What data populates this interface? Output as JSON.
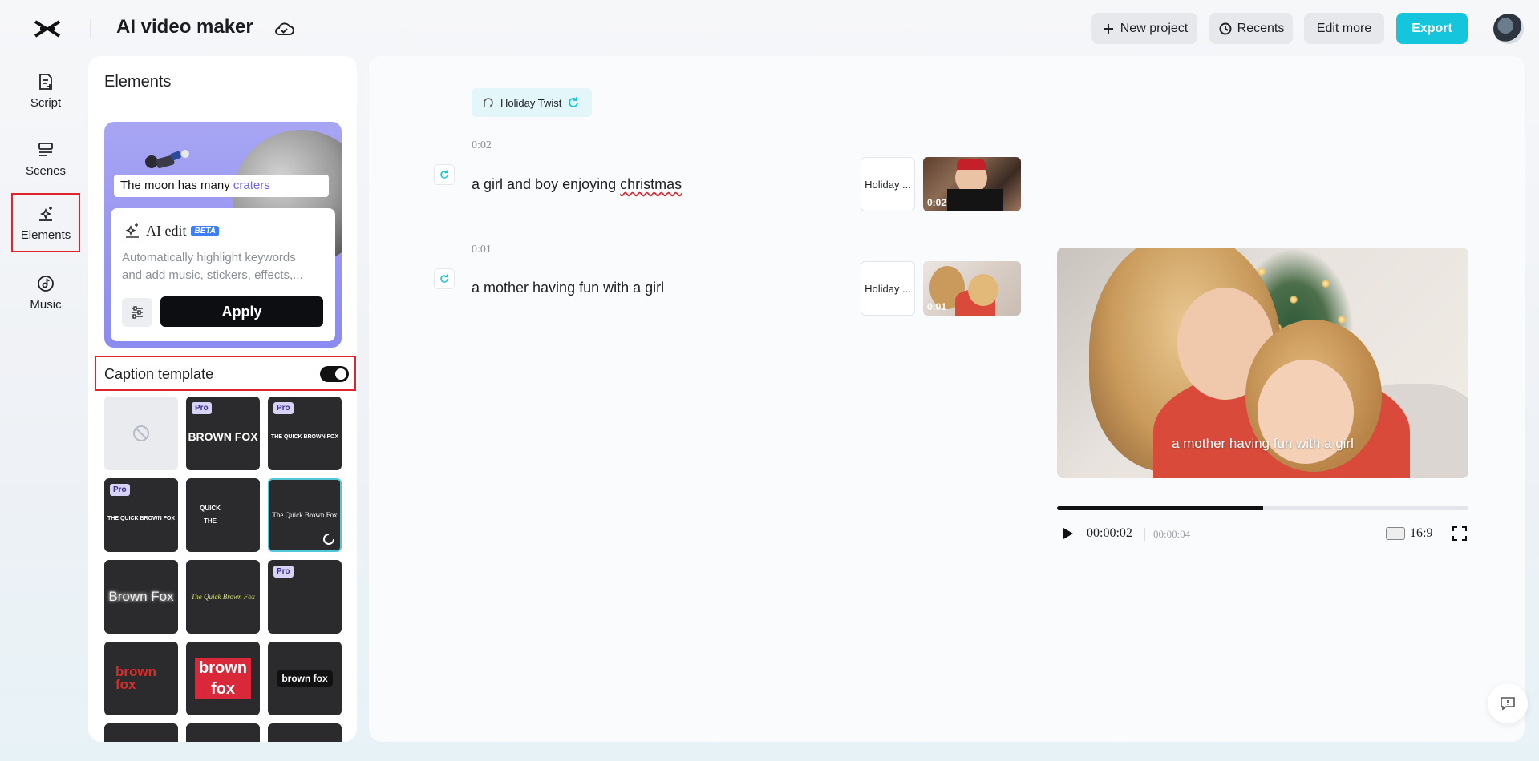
{
  "app": {
    "title": "AI video maker"
  },
  "toolbar": {
    "new_project": "New project",
    "recents": "Recents",
    "edit_more": "Edit more",
    "export": "Export"
  },
  "nav": [
    {
      "label": "Script",
      "icon": "script-icon"
    },
    {
      "label": "Scenes",
      "icon": "scenes-icon"
    },
    {
      "label": "Elements",
      "icon": "elements-sparkle-icon",
      "selected": true
    },
    {
      "label": "Music",
      "icon": "music-icon"
    }
  ],
  "panel": {
    "title": "Elements",
    "ai_card": {
      "caption_plain": "The moon has many ",
      "caption_highlight": "craters",
      "heading": "AI edit",
      "badge": "BETA",
      "desc_line1": "Automatically highlight keywords",
      "desc_line2": "and add music, stickers, effects,...",
      "apply": "Apply"
    },
    "caption_template": {
      "label": "Caption template",
      "enabled": true
    },
    "templates": [
      {
        "text": "",
        "pro": false,
        "none": true
      },
      {
        "text": "BROWN FOX",
        "pro": true
      },
      {
        "text": "THE QUICK BROWN FOX",
        "pro": true
      },
      {
        "text": "THE QUICK BROWN FOX",
        "pro": true
      },
      {
        "text": "QUICK THE",
        "pro": false
      },
      {
        "text": "The Quick Brown Fox",
        "pro": false,
        "selected": true
      },
      {
        "text": "Brown Fox",
        "pro": false
      },
      {
        "text": "The Quick Brown Fox",
        "pro": false
      },
      {
        "text": "",
        "pro": true
      },
      {
        "text": "brown fox",
        "pro": false
      },
      {
        "text": "brown fox",
        "pro": false
      },
      {
        "text": "brown fox",
        "pro": false
      }
    ],
    "pro_label": "Pro"
  },
  "main": {
    "voice": "Holiday Twist",
    "scenes": [
      {
        "time": "0:02",
        "text_before": "a girl and boy enjoying ",
        "text_marked": "christmas",
        "chip": "Holiday ...",
        "thumb_time": "0:02"
      },
      {
        "time": "0:01",
        "text_before": "a mother having fun with a girl",
        "text_marked": "",
        "chip": "Holiday ...",
        "thumb_time": "0:01"
      }
    ],
    "preview_caption": "a mother having fun with a girl",
    "player": {
      "current": "00:00:02",
      "total": "00:00:04",
      "ratio": "16:9",
      "progress": 0.5
    }
  },
  "colors": {
    "accent": "#14c5dc",
    "highlight": "#e0242b",
    "ai_card": "#8b8bf0"
  }
}
